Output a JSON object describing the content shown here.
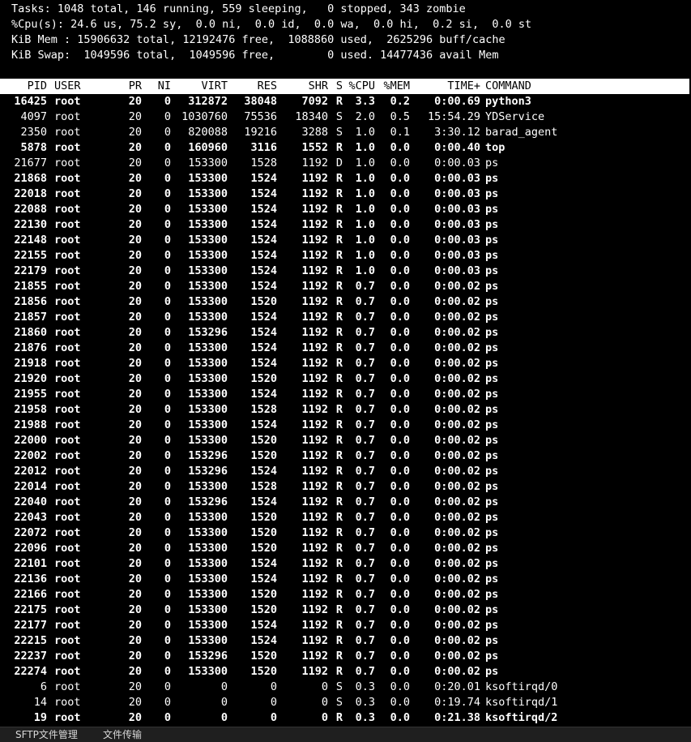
{
  "summary": {
    "tasks": "Tasks: 1048 total, 146 running, 559 sleeping,   0 stopped, 343 zombie",
    "cpu": "%Cpu(s): 24.6 us, 75.2 sy,  0.0 ni,  0.0 id,  0.0 wa,  0.0 hi,  0.2 si,  0.0 st",
    "mem": "KiB Mem : 15906632 total, 12192476 free,  1088860 used,  2625296 buff/cache",
    "swap": "KiB Swap:  1049596 total,  1049596 free,        0 used. 14477436 avail Mem"
  },
  "columns": {
    "pid": "PID",
    "user": "USER",
    "pr": "PR",
    "ni": "NI",
    "virt": "VIRT",
    "res": "RES",
    "shr": "SHR",
    "s": "S",
    "cpu": "%CPU",
    "mem": "%MEM",
    "time": "TIME+",
    "command": "COMMAND"
  },
  "processes": [
    {
      "pid": "16425",
      "user": "root",
      "pr": "20",
      "ni": "0",
      "virt": "312872",
      "res": "38048",
      "shr": "7092",
      "s": "R",
      "cpu": "3.3",
      "mem": "0.2",
      "time": "0:00.69",
      "command": "python3",
      "bold": true
    },
    {
      "pid": "4097",
      "user": "root",
      "pr": "20",
      "ni": "0",
      "virt": "1030760",
      "res": "75536",
      "shr": "18340",
      "s": "S",
      "cpu": "2.0",
      "mem": "0.5",
      "time": "15:54.29",
      "command": "YDService",
      "bold": false
    },
    {
      "pid": "2350",
      "user": "root",
      "pr": "20",
      "ni": "0",
      "virt": "820088",
      "res": "19216",
      "shr": "3288",
      "s": "S",
      "cpu": "1.0",
      "mem": "0.1",
      "time": "3:30.12",
      "command": "barad_agent",
      "bold": false
    },
    {
      "pid": "5878",
      "user": "root",
      "pr": "20",
      "ni": "0",
      "virt": "160960",
      "res": "3116",
      "shr": "1552",
      "s": "R",
      "cpu": "1.0",
      "mem": "0.0",
      "time": "0:00.40",
      "command": "top",
      "bold": true
    },
    {
      "pid": "21677",
      "user": "root",
      "pr": "20",
      "ni": "0",
      "virt": "153300",
      "res": "1528",
      "shr": "1192",
      "s": "D",
      "cpu": "1.0",
      "mem": "0.0",
      "time": "0:00.03",
      "command": "ps",
      "bold": false
    },
    {
      "pid": "21868",
      "user": "root",
      "pr": "20",
      "ni": "0",
      "virt": "153300",
      "res": "1524",
      "shr": "1192",
      "s": "R",
      "cpu": "1.0",
      "mem": "0.0",
      "time": "0:00.03",
      "command": "ps",
      "bold": true
    },
    {
      "pid": "22018",
      "user": "root",
      "pr": "20",
      "ni": "0",
      "virt": "153300",
      "res": "1524",
      "shr": "1192",
      "s": "R",
      "cpu": "1.0",
      "mem": "0.0",
      "time": "0:00.03",
      "command": "ps",
      "bold": true
    },
    {
      "pid": "22088",
      "user": "root",
      "pr": "20",
      "ni": "0",
      "virt": "153300",
      "res": "1524",
      "shr": "1192",
      "s": "R",
      "cpu": "1.0",
      "mem": "0.0",
      "time": "0:00.03",
      "command": "ps",
      "bold": true
    },
    {
      "pid": "22130",
      "user": "root",
      "pr": "20",
      "ni": "0",
      "virt": "153300",
      "res": "1524",
      "shr": "1192",
      "s": "R",
      "cpu": "1.0",
      "mem": "0.0",
      "time": "0:00.03",
      "command": "ps",
      "bold": true
    },
    {
      "pid": "22148",
      "user": "root",
      "pr": "20",
      "ni": "0",
      "virt": "153300",
      "res": "1524",
      "shr": "1192",
      "s": "R",
      "cpu": "1.0",
      "mem": "0.0",
      "time": "0:00.03",
      "command": "ps",
      "bold": true
    },
    {
      "pid": "22155",
      "user": "root",
      "pr": "20",
      "ni": "0",
      "virt": "153300",
      "res": "1524",
      "shr": "1192",
      "s": "R",
      "cpu": "1.0",
      "mem": "0.0",
      "time": "0:00.03",
      "command": "ps",
      "bold": true
    },
    {
      "pid": "22179",
      "user": "root",
      "pr": "20",
      "ni": "0",
      "virt": "153300",
      "res": "1524",
      "shr": "1192",
      "s": "R",
      "cpu": "1.0",
      "mem": "0.0",
      "time": "0:00.03",
      "command": "ps",
      "bold": true
    },
    {
      "pid": "21855",
      "user": "root",
      "pr": "20",
      "ni": "0",
      "virt": "153300",
      "res": "1524",
      "shr": "1192",
      "s": "R",
      "cpu": "0.7",
      "mem": "0.0",
      "time": "0:00.02",
      "command": "ps",
      "bold": true
    },
    {
      "pid": "21856",
      "user": "root",
      "pr": "20",
      "ni": "0",
      "virt": "153300",
      "res": "1520",
      "shr": "1192",
      "s": "R",
      "cpu": "0.7",
      "mem": "0.0",
      "time": "0:00.02",
      "command": "ps",
      "bold": true
    },
    {
      "pid": "21857",
      "user": "root",
      "pr": "20",
      "ni": "0",
      "virt": "153300",
      "res": "1524",
      "shr": "1192",
      "s": "R",
      "cpu": "0.7",
      "mem": "0.0",
      "time": "0:00.02",
      "command": "ps",
      "bold": true
    },
    {
      "pid": "21860",
      "user": "root",
      "pr": "20",
      "ni": "0",
      "virt": "153296",
      "res": "1524",
      "shr": "1192",
      "s": "R",
      "cpu": "0.7",
      "mem": "0.0",
      "time": "0:00.02",
      "command": "ps",
      "bold": true
    },
    {
      "pid": "21876",
      "user": "root",
      "pr": "20",
      "ni": "0",
      "virt": "153300",
      "res": "1524",
      "shr": "1192",
      "s": "R",
      "cpu": "0.7",
      "mem": "0.0",
      "time": "0:00.02",
      "command": "ps",
      "bold": true
    },
    {
      "pid": "21918",
      "user": "root",
      "pr": "20",
      "ni": "0",
      "virt": "153300",
      "res": "1524",
      "shr": "1192",
      "s": "R",
      "cpu": "0.7",
      "mem": "0.0",
      "time": "0:00.02",
      "command": "ps",
      "bold": true
    },
    {
      "pid": "21920",
      "user": "root",
      "pr": "20",
      "ni": "0",
      "virt": "153300",
      "res": "1520",
      "shr": "1192",
      "s": "R",
      "cpu": "0.7",
      "mem": "0.0",
      "time": "0:00.02",
      "command": "ps",
      "bold": true
    },
    {
      "pid": "21955",
      "user": "root",
      "pr": "20",
      "ni": "0",
      "virt": "153300",
      "res": "1524",
      "shr": "1192",
      "s": "R",
      "cpu": "0.7",
      "mem": "0.0",
      "time": "0:00.02",
      "command": "ps",
      "bold": true
    },
    {
      "pid": "21958",
      "user": "root",
      "pr": "20",
      "ni": "0",
      "virt": "153300",
      "res": "1528",
      "shr": "1192",
      "s": "R",
      "cpu": "0.7",
      "mem": "0.0",
      "time": "0:00.02",
      "command": "ps",
      "bold": true
    },
    {
      "pid": "21988",
      "user": "root",
      "pr": "20",
      "ni": "0",
      "virt": "153300",
      "res": "1524",
      "shr": "1192",
      "s": "R",
      "cpu": "0.7",
      "mem": "0.0",
      "time": "0:00.02",
      "command": "ps",
      "bold": true
    },
    {
      "pid": "22000",
      "user": "root",
      "pr": "20",
      "ni": "0",
      "virt": "153300",
      "res": "1520",
      "shr": "1192",
      "s": "R",
      "cpu": "0.7",
      "mem": "0.0",
      "time": "0:00.02",
      "command": "ps",
      "bold": true
    },
    {
      "pid": "22002",
      "user": "root",
      "pr": "20",
      "ni": "0",
      "virt": "153296",
      "res": "1520",
      "shr": "1192",
      "s": "R",
      "cpu": "0.7",
      "mem": "0.0",
      "time": "0:00.02",
      "command": "ps",
      "bold": true
    },
    {
      "pid": "22012",
      "user": "root",
      "pr": "20",
      "ni": "0",
      "virt": "153296",
      "res": "1524",
      "shr": "1192",
      "s": "R",
      "cpu": "0.7",
      "mem": "0.0",
      "time": "0:00.02",
      "command": "ps",
      "bold": true
    },
    {
      "pid": "22014",
      "user": "root",
      "pr": "20",
      "ni": "0",
      "virt": "153300",
      "res": "1528",
      "shr": "1192",
      "s": "R",
      "cpu": "0.7",
      "mem": "0.0",
      "time": "0:00.02",
      "command": "ps",
      "bold": true
    },
    {
      "pid": "22040",
      "user": "root",
      "pr": "20",
      "ni": "0",
      "virt": "153296",
      "res": "1524",
      "shr": "1192",
      "s": "R",
      "cpu": "0.7",
      "mem": "0.0",
      "time": "0:00.02",
      "command": "ps",
      "bold": true
    },
    {
      "pid": "22043",
      "user": "root",
      "pr": "20",
      "ni": "0",
      "virt": "153300",
      "res": "1520",
      "shr": "1192",
      "s": "R",
      "cpu": "0.7",
      "mem": "0.0",
      "time": "0:00.02",
      "command": "ps",
      "bold": true
    },
    {
      "pid": "22072",
      "user": "root",
      "pr": "20",
      "ni": "0",
      "virt": "153300",
      "res": "1520",
      "shr": "1192",
      "s": "R",
      "cpu": "0.7",
      "mem": "0.0",
      "time": "0:00.02",
      "command": "ps",
      "bold": true
    },
    {
      "pid": "22096",
      "user": "root",
      "pr": "20",
      "ni": "0",
      "virt": "153300",
      "res": "1520",
      "shr": "1192",
      "s": "R",
      "cpu": "0.7",
      "mem": "0.0",
      "time": "0:00.02",
      "command": "ps",
      "bold": true
    },
    {
      "pid": "22101",
      "user": "root",
      "pr": "20",
      "ni": "0",
      "virt": "153300",
      "res": "1524",
      "shr": "1192",
      "s": "R",
      "cpu": "0.7",
      "mem": "0.0",
      "time": "0:00.02",
      "command": "ps",
      "bold": true
    },
    {
      "pid": "22136",
      "user": "root",
      "pr": "20",
      "ni": "0",
      "virt": "153300",
      "res": "1524",
      "shr": "1192",
      "s": "R",
      "cpu": "0.7",
      "mem": "0.0",
      "time": "0:00.02",
      "command": "ps",
      "bold": true
    },
    {
      "pid": "22166",
      "user": "root",
      "pr": "20",
      "ni": "0",
      "virt": "153300",
      "res": "1520",
      "shr": "1192",
      "s": "R",
      "cpu": "0.7",
      "mem": "0.0",
      "time": "0:00.02",
      "command": "ps",
      "bold": true
    },
    {
      "pid": "22175",
      "user": "root",
      "pr": "20",
      "ni": "0",
      "virt": "153300",
      "res": "1520",
      "shr": "1192",
      "s": "R",
      "cpu": "0.7",
      "mem": "0.0",
      "time": "0:00.02",
      "command": "ps",
      "bold": true
    },
    {
      "pid": "22177",
      "user": "root",
      "pr": "20",
      "ni": "0",
      "virt": "153300",
      "res": "1524",
      "shr": "1192",
      "s": "R",
      "cpu": "0.7",
      "mem": "0.0",
      "time": "0:00.02",
      "command": "ps",
      "bold": true
    },
    {
      "pid": "22215",
      "user": "root",
      "pr": "20",
      "ni": "0",
      "virt": "153300",
      "res": "1524",
      "shr": "1192",
      "s": "R",
      "cpu": "0.7",
      "mem": "0.0",
      "time": "0:00.02",
      "command": "ps",
      "bold": true
    },
    {
      "pid": "22237",
      "user": "root",
      "pr": "20",
      "ni": "0",
      "virt": "153296",
      "res": "1520",
      "shr": "1192",
      "s": "R",
      "cpu": "0.7",
      "mem": "0.0",
      "time": "0:00.02",
      "command": "ps",
      "bold": true
    },
    {
      "pid": "22274",
      "user": "root",
      "pr": "20",
      "ni": "0",
      "virt": "153300",
      "res": "1520",
      "shr": "1192",
      "s": "R",
      "cpu": "0.7",
      "mem": "0.0",
      "time": "0:00.02",
      "command": "ps",
      "bold": true
    },
    {
      "pid": "6",
      "user": "root",
      "pr": "20",
      "ni": "0",
      "virt": "0",
      "res": "0",
      "shr": "0",
      "s": "S",
      "cpu": "0.3",
      "mem": "0.0",
      "time": "0:20.01",
      "command": "ksoftirqd/0",
      "bold": false
    },
    {
      "pid": "14",
      "user": "root",
      "pr": "20",
      "ni": "0",
      "virt": "0",
      "res": "0",
      "shr": "0",
      "s": "S",
      "cpu": "0.3",
      "mem": "0.0",
      "time": "0:19.74",
      "command": "ksoftirqd/1",
      "bold": false
    },
    {
      "pid": "19",
      "user": "root",
      "pr": "20",
      "ni": "0",
      "virt": "0",
      "res": "0",
      "shr": "0",
      "s": "R",
      "cpu": "0.3",
      "mem": "0.0",
      "time": "0:21.38",
      "command": "ksoftirqd/2",
      "bold": true
    }
  ],
  "statusbar": {
    "sftp_tab": "SFTP文件管理",
    "transfer_tab": "文件传输"
  }
}
